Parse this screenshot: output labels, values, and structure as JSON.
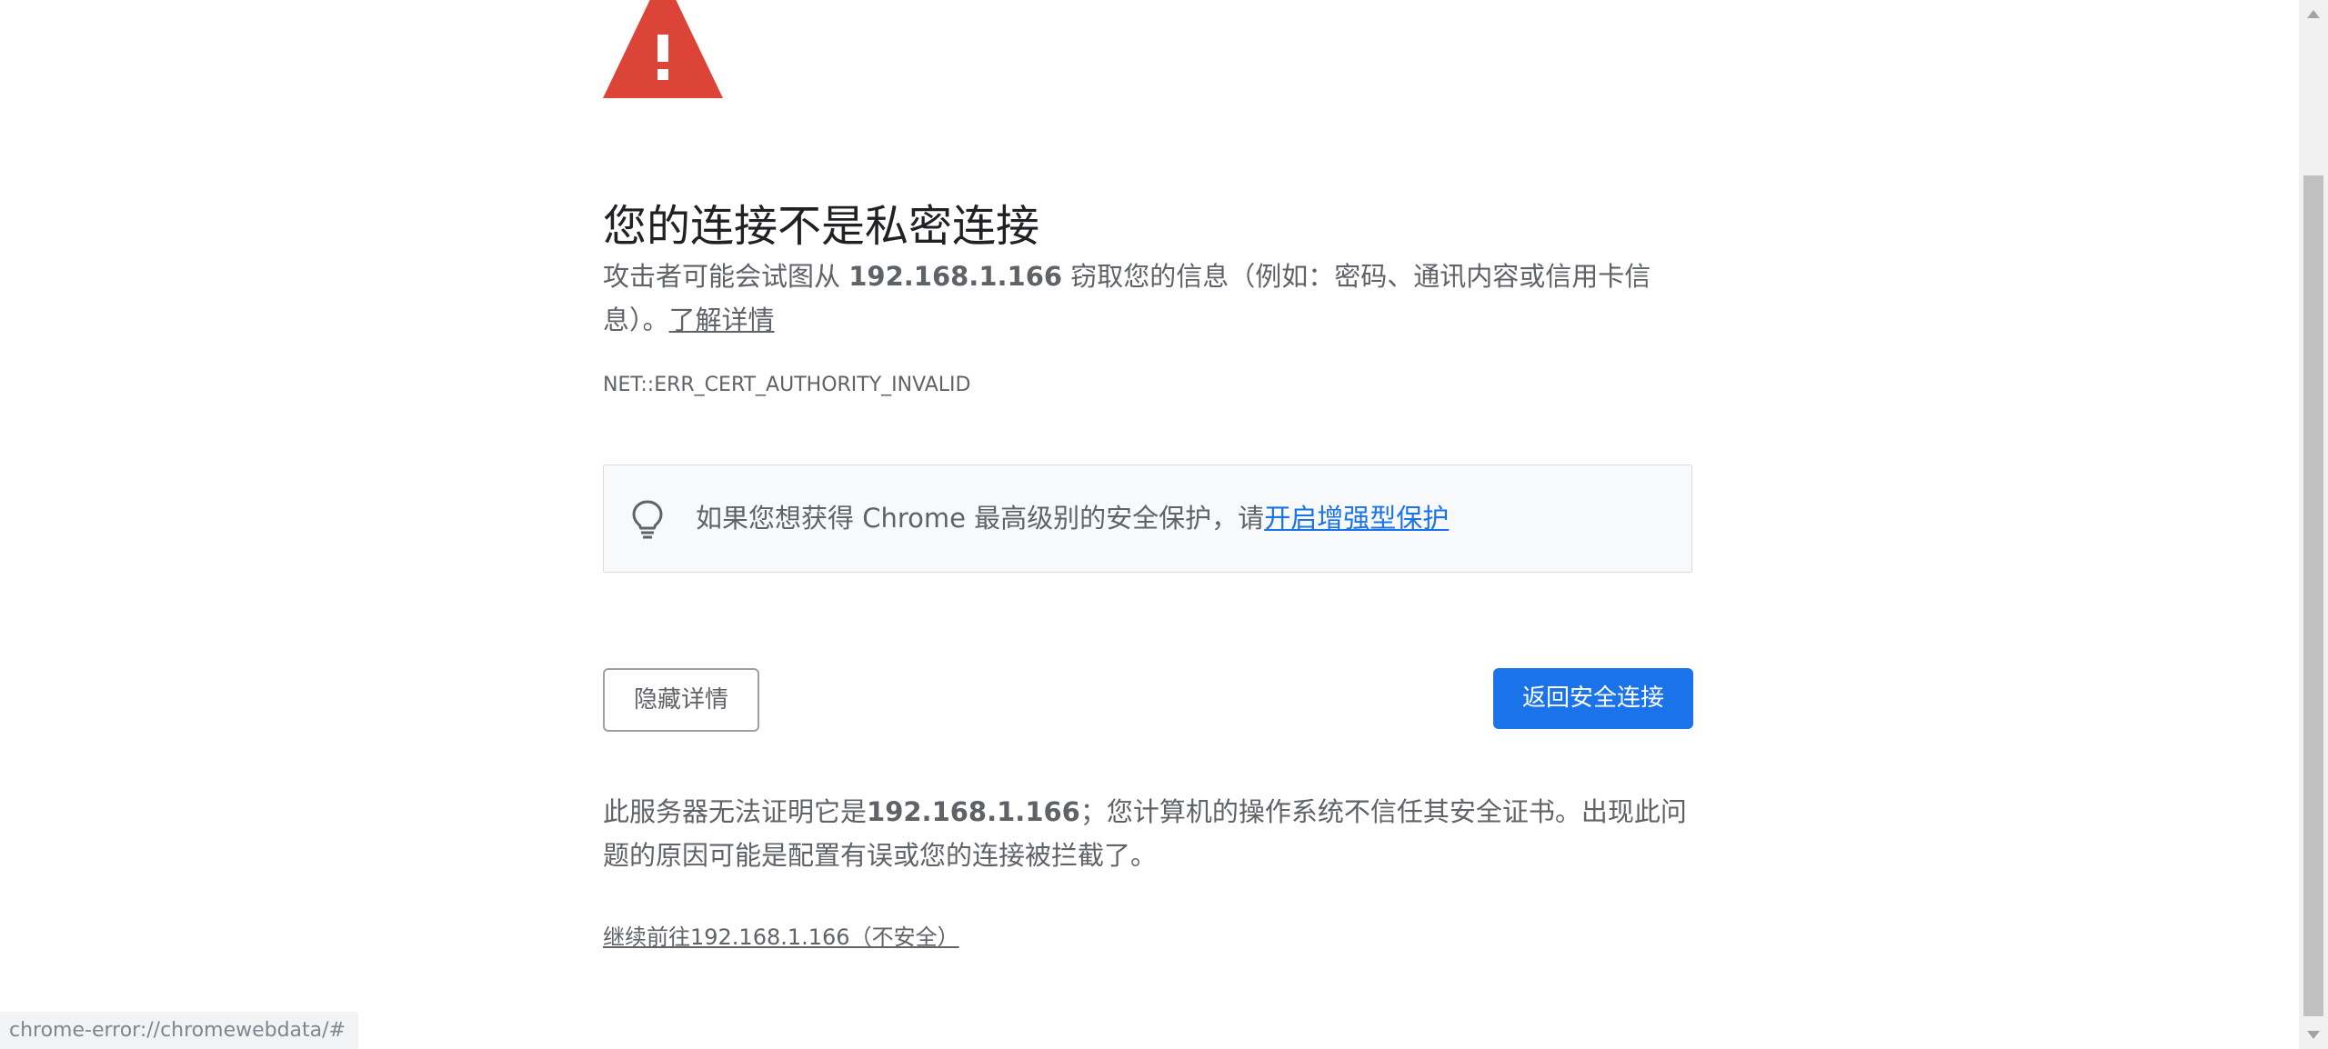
{
  "interstitial": {
    "title": "您的连接不是私密连接",
    "explanation": {
      "prefix": "攻击者可能会试图从 ",
      "host": "192.168.1.166",
      "suffix": " 窃取您的信息（例如：密码、通讯内容或信用卡信息）。",
      "learn_more": "了解详情"
    },
    "error_code": "NET::ERR_CERT_AUTHORITY_INVALID",
    "promo": {
      "icon": "lightbulb-icon",
      "text": "如果您想获得 Chrome 最高级别的安全保护，请",
      "link": "开启增强型保护"
    },
    "buttons": {
      "details": "隐藏详情",
      "back": "返回安全连接"
    },
    "details": {
      "prefix": "此服务器无法证明它是",
      "host": "192.168.1.166",
      "suffix": "；您计算机的操作系统不信任其安全证书。出现此问题的原因可能是配置有误或您的连接被拦截了。"
    },
    "proceed_link": "继续前往192.168.1.166（不安全）"
  },
  "status_bar": {
    "url": "chrome-error://chromewebdata/#"
  },
  "colors": {
    "warning_red": "#db4437",
    "primary_blue": "#1a73e8",
    "text_secondary": "#5f6368",
    "text_primary": "#202124",
    "promo_bg": "#f8f9fa"
  }
}
